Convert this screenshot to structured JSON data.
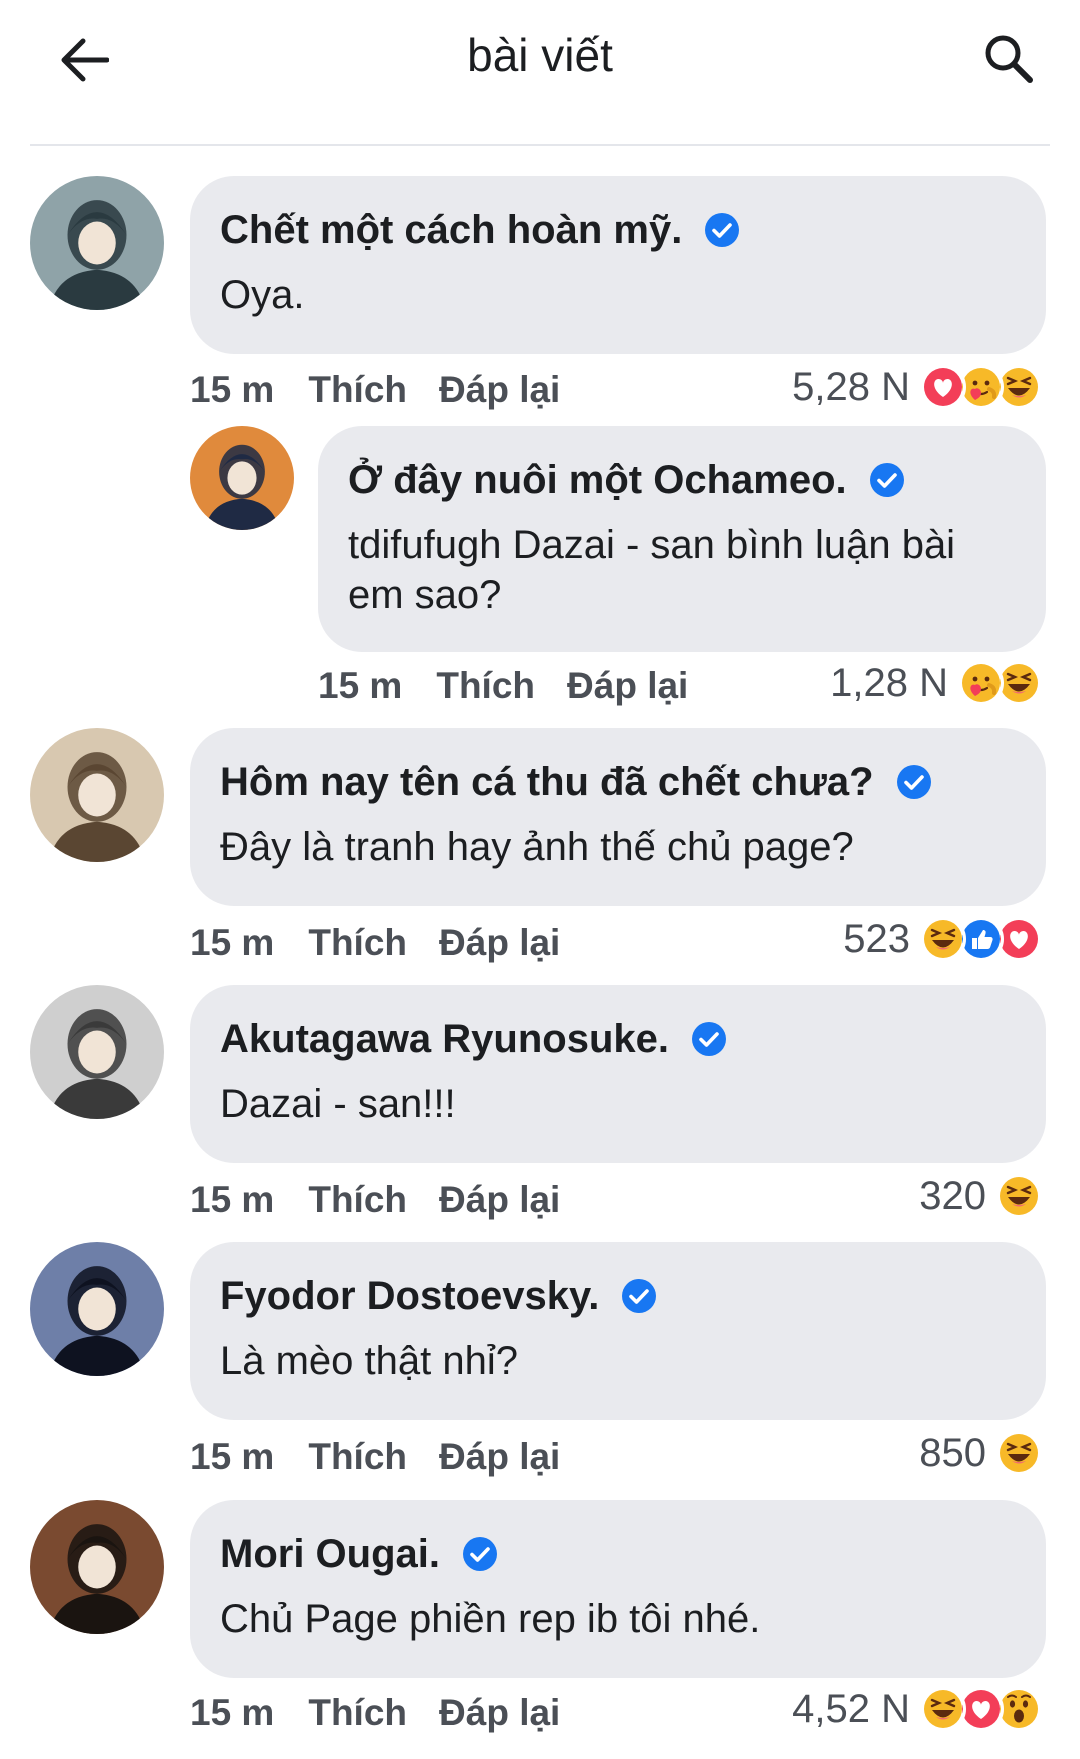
{
  "header": {
    "title": "bài viết",
    "back_icon": "arrow-left-icon",
    "search_icon": "search-icon"
  },
  "comments": [
    {
      "author": "Chết một cách hoàn mỹ.",
      "text": "Oya.",
      "time": "15 m",
      "like_label": "Thích",
      "reply_label": "Đáp lại",
      "reaction_count": "5,28 N",
      "reactions": [
        "love",
        "care",
        "haha"
      ],
      "avatar_colors": [
        "#2a3a40",
        "#8fa3a8"
      ]
    },
    {
      "author": "Ở đây nuôi một Ochameo.",
      "text": "tdifufugh Dazai - san bình luận bài em sao?",
      "time": "15 m",
      "like_label": "Thích",
      "reply_label": "Đáp lại",
      "reaction_count": "1,28 N",
      "reactions": [
        "care",
        "haha"
      ],
      "avatar_colors": [
        "#1f2a44",
        "#e08a3c"
      ]
    },
    {
      "author": "Hôm nay tên cá thu đã chết chưa?",
      "text": "Đây là tranh hay ảnh thế chủ page?",
      "time": "15 m",
      "like_label": "Thích",
      "reply_label": "Đáp lại",
      "reaction_count": "523",
      "reactions": [
        "haha",
        "like",
        "love"
      ],
      "avatar_colors": [
        "#5a4632",
        "#d8c8b0"
      ]
    },
    {
      "author": "Akutagawa Ryunosuke.",
      "text": "Dazai - san!!!",
      "time": "15 m",
      "like_label": "Thích",
      "reply_label": "Đáp lại",
      "reaction_count": "320",
      "reactions": [
        "haha"
      ],
      "avatar_colors": [
        "#3a3a3a",
        "#cfcfcf"
      ]
    },
    {
      "author": "Fyodor Dostoevsky.",
      "text": "Là mèo thật nhỉ?",
      "time": "15 m",
      "like_label": "Thích",
      "reply_label": "Đáp lại",
      "reaction_count": "850",
      "reactions": [
        "haha"
      ],
      "avatar_colors": [
        "#0e1220",
        "#6e7fa8"
      ]
    },
    {
      "author": "Mori Ougai.",
      "text": "Chủ Page phiền rep ib tôi nhé.",
      "time": "15 m",
      "like_label": "Thích",
      "reply_label": "Đáp lại",
      "reaction_count": "4,52 N",
      "reactions": [
        "haha",
        "love",
        "wow"
      ],
      "avatar_colors": [
        "#1a1410",
        "#7a4a30"
      ]
    }
  ],
  "colors": {
    "verified": "#1877f2",
    "bubble": "#e9eaee",
    "love": "#f33e58",
    "like": "#1877f2",
    "emoji_yellow": "#f7b928"
  }
}
